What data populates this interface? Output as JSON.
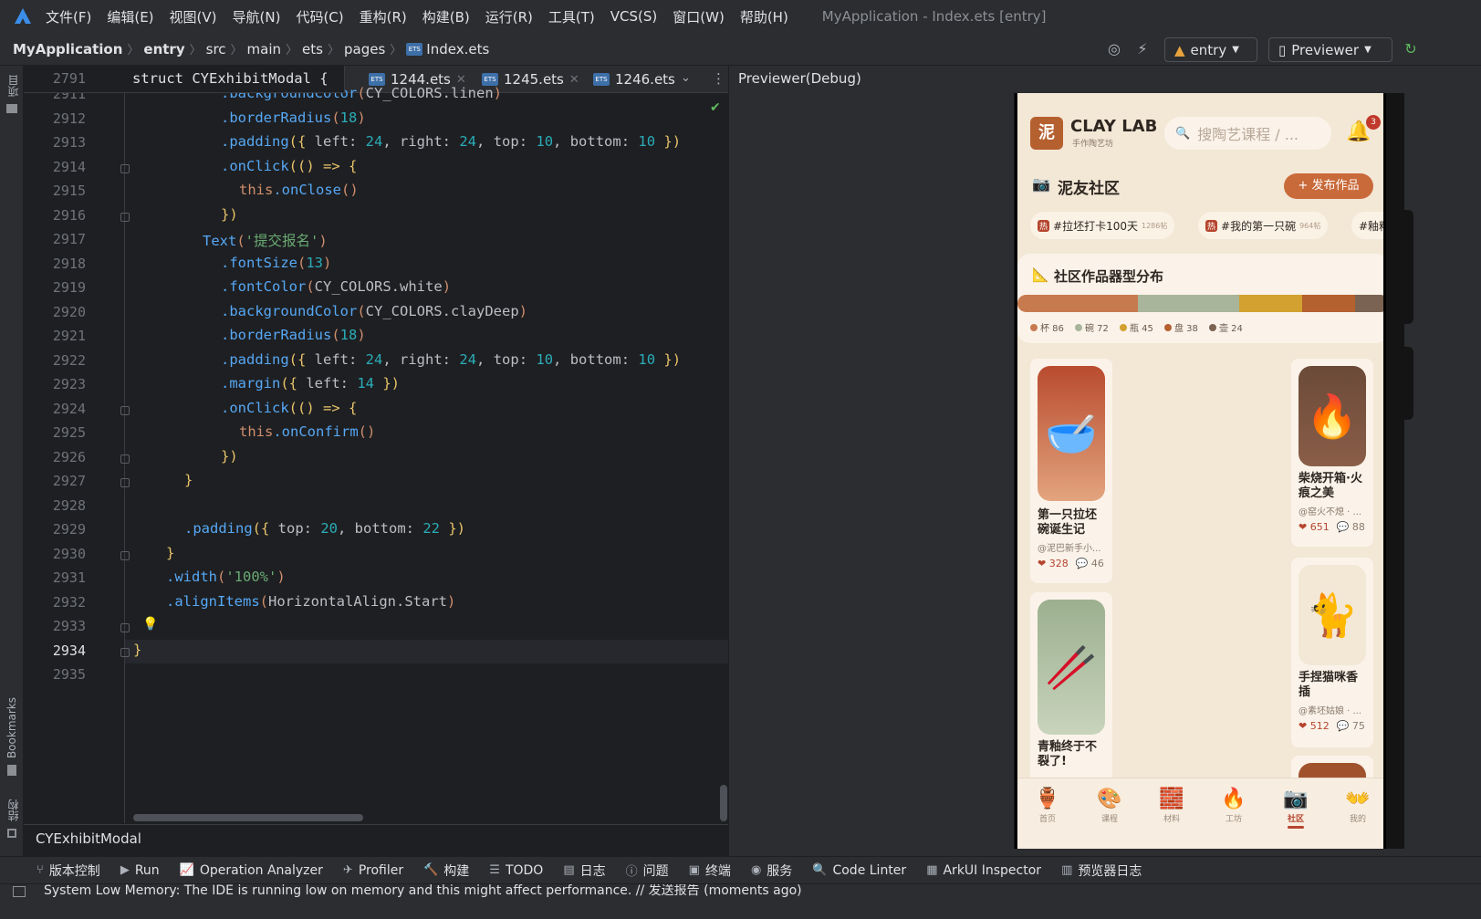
{
  "menubar": {
    "items": [
      "文件(F)",
      "编辑(E)",
      "视图(V)",
      "导航(N)",
      "代码(C)",
      "重构(R)",
      "构建(B)",
      "运行(R)",
      "工具(T)",
      "VCS(S)",
      "窗口(W)",
      "帮助(H)"
    ],
    "window_title": "MyApplication - Index.ets [entry]"
  },
  "breadcrumb": {
    "items": [
      "MyApplication",
      "entry",
      "src",
      "main",
      "ets",
      "pages",
      "Index.ets"
    ]
  },
  "toolbar": {
    "run_config": "entry",
    "device": "Previewer"
  },
  "editor": {
    "sticky_line_number": "2791",
    "sticky_text": "struct CYExhibitModal {",
    "tabs": [
      "1244.ets",
      "1245.ets",
      "1246.ets"
    ],
    "bottom_crumb": "CYExhibitModal",
    "lines": [
      {
        "num": "2911",
        "code": ".backgroundColor(CY_COLORS.linen)"
      },
      {
        "num": "2912",
        "code": ".borderRadius(18)"
      },
      {
        "num": "2913",
        "code": ".padding({ left: 24, right: 24, top: 10, bottom: 10 })"
      },
      {
        "num": "2914",
        "code": ".onClick(() => {"
      },
      {
        "num": "2915",
        "code": "this.onClose()"
      },
      {
        "num": "2916",
        "code": "})"
      },
      {
        "num": "2917",
        "code": "Text('提交报名')"
      },
      {
        "num": "2918",
        "code": ".fontSize(13)"
      },
      {
        "num": "2919",
        "code": ".fontColor(CY_COLORS.white)"
      },
      {
        "num": "2920",
        "code": ".backgroundColor(CY_COLORS.clayDeep)"
      },
      {
        "num": "2921",
        "code": ".borderRadius(18)"
      },
      {
        "num": "2922",
        "code": ".padding({ left: 24, right: 24, top: 10, bottom: 10 })"
      },
      {
        "num": "2923",
        "code": ".margin({ left: 14 })"
      },
      {
        "num": "2924",
        "code": ".onClick(() => {"
      },
      {
        "num": "2925",
        "code": "this.onConfirm()"
      },
      {
        "num": "2926",
        "code": "})"
      },
      {
        "num": "2927",
        "code": "}"
      },
      {
        "num": "2928",
        "code": ""
      },
      {
        "num": "2929",
        "code": ".padding({ top: 20, bottom: 22 })"
      },
      {
        "num": "2930",
        "code": "}"
      },
      {
        "num": "2931",
        "code": ".width('100%')"
      },
      {
        "num": "2932",
        "code": ".alignItems(HorizontalAlign.Start)"
      },
      {
        "num": "2933",
        "code": ""
      },
      {
        "num": "2934",
        "code": "}"
      },
      {
        "num": "2935",
        "code": ""
      }
    ]
  },
  "side_labels": {
    "project": "项目",
    "bookmarks": "Bookmarks",
    "structure": "结构"
  },
  "preview": {
    "title": "Previewer(Debug)",
    "app": {
      "logo_char": "泥",
      "brand": "CLAY LAB",
      "brand_sub": "手作陶艺坊",
      "search_placeholder": "搜陶艺课程 / ...",
      "notification_count": "3",
      "section_title": "泥友社区",
      "post_button": "+ 发布作品",
      "topics": [
        {
          "hot": "热",
          "label": "#拉坯打卡100天",
          "count": "1286帖"
        },
        {
          "hot": "热",
          "label": "#我的第一只碗",
          "count": "964帖"
        },
        {
          "hot": "",
          "label": "#釉料",
          "count": ""
        }
      ],
      "distribution_title": "社区作品器型分布",
      "distribution": [
        {
          "label": "杯",
          "value": 86,
          "color": "#c87a4f"
        },
        {
          "label": "碗",
          "value": 72,
          "color": "#a8b59a"
        },
        {
          "label": "瓶",
          "value": 45,
          "color": "#d3a12f"
        },
        {
          "label": "盘",
          "value": 38,
          "color": "#b5602f"
        },
        {
          "label": "壶",
          "value": 24,
          "color": "#7a6352"
        }
      ],
      "posts": [
        {
          "title": "第一只拉坯碗诞生记",
          "author": "@泥巴新手小...",
          "likes": "328",
          "comments": "46",
          "icon": "bowl-icon",
          "glyph": "🥣"
        },
        {
          "title": "柴烧开箱·火痕之美",
          "author": "@窑火不熄 · ...",
          "likes": "651",
          "comments": "88",
          "icon": "fire-icon",
          "glyph": "🔥"
        },
        {
          "title": "青釉终于不裂了!",
          "author": "",
          "likes": "",
          "comments": "",
          "icon": "chopsticks-icon",
          "glyph": "🥢"
        },
        {
          "title": "手捏猫咪香插",
          "author": "@素坯姑娘 · ...",
          "likes": "512",
          "comments": "75",
          "icon": "cat-icon",
          "glyph": "🐈"
        }
      ],
      "tabs": [
        {
          "label": "首页",
          "glyph": "🏺",
          "icon": "vase-icon"
        },
        {
          "label": "课程",
          "glyph": "🎨",
          "icon": "palette-icon"
        },
        {
          "label": "材料",
          "glyph": "🧱",
          "icon": "brick-icon"
        },
        {
          "label": "工坊",
          "glyph": "🔥",
          "icon": "kiln-icon"
        },
        {
          "label": "社区",
          "glyph": "📷",
          "icon": "camera-icon"
        },
        {
          "label": "我的",
          "glyph": "👐",
          "icon": "hands-icon"
        }
      ],
      "active_tab": "社区"
    }
  },
  "bottom_tools": [
    "版本控制",
    "Run",
    "Operation Analyzer",
    "Profiler",
    "构建",
    "TODO",
    "日志",
    "问题",
    "终端",
    "服务",
    "Code Linter",
    "ArkUI Inspector",
    "预览器日志"
  ],
  "status": "System Low Memory: The IDE is running low on memory and this might affect performance. // 发送报告 (moments ago)"
}
